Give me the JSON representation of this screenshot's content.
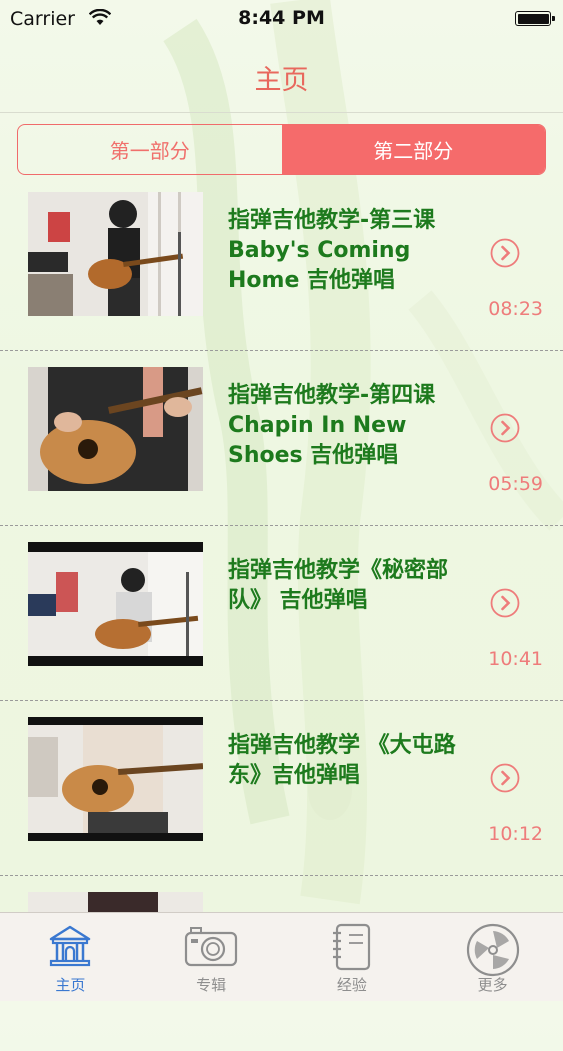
{
  "status_bar": {
    "carrier": "Carrier",
    "time": "8:44 PM"
  },
  "nav": {
    "title": "主页"
  },
  "segmented": {
    "items": [
      {
        "label": "第一部分",
        "selected": false
      },
      {
        "label": "第二部分",
        "selected": true
      }
    ]
  },
  "lessons": [
    {
      "title": "指弹吉他教学-第三课 Baby's Coming Home 吉他弹唱",
      "duration": "08:23"
    },
    {
      "title": "指弹吉他教学-第四课 Chapin In New Shoes 吉他弹唱",
      "duration": "05:59"
    },
    {
      "title": "指弹吉他教学《秘密部队》 吉他弹唱",
      "duration": "10:41"
    },
    {
      "title": "指弹吉他教学 《大屯路东》吉他弹唱",
      "duration": "10:12"
    }
  ],
  "tab_bar": {
    "tabs": [
      {
        "label": "主页",
        "icon": "home-icon",
        "active": true
      },
      {
        "label": "专辑",
        "icon": "camera-icon",
        "active": false
      },
      {
        "label": "经验",
        "icon": "notebook-icon",
        "active": false
      },
      {
        "label": "更多",
        "icon": "more-icon",
        "active": false
      }
    ]
  },
  "colors": {
    "accent": "#f56b6b",
    "title_green": "#1d7a1d",
    "duration": "#ee7c7b",
    "tab_active": "#3a78d0"
  }
}
